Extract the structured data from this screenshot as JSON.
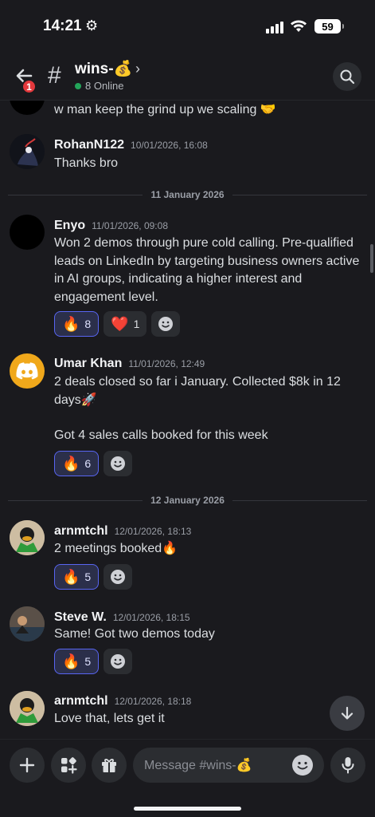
{
  "status_bar": {
    "time": "14:21",
    "battery": "59"
  },
  "header": {
    "back_badge": "1",
    "channel_name": "wins-💰",
    "online": "8 Online"
  },
  "messages": [
    {
      "text": "w man keep the grind up we scaling 🤝"
    },
    {
      "author": "RohanN122",
      "timestamp": "10/01/2026, 16:08",
      "text": "Thanks bro"
    },
    {
      "author": "Enyo",
      "timestamp": "11/01/2026, 09:08",
      "text": "Won 2 demos through pure cold calling. Pre-qualified leads on LinkedIn by targeting business owners active in AI groups, indicating a higher interest and engagement level.",
      "reactions": [
        {
          "emoji": "🔥",
          "count": "8"
        },
        {
          "emoji": "❤️",
          "count": "1"
        }
      ]
    },
    {
      "author": "Umar Khan",
      "timestamp": "11/01/2026, 12:49",
      "text": "2 deals closed so far i January. Collected $8k in 12 days🚀",
      "text2": "Got 4 sales calls booked for this week",
      "reactions": [
        {
          "emoji": "🔥",
          "count": "6"
        }
      ]
    },
    {
      "author": "arnmtchl",
      "timestamp": "12/01/2026, 18:13",
      "text": "2 meetings booked🔥",
      "reactions": [
        {
          "emoji": "🔥",
          "count": "5"
        }
      ]
    },
    {
      "author": "Steve W.",
      "timestamp": "12/01/2026, 18:15",
      "text": "Same! Got two demos today",
      "reactions": [
        {
          "emoji": "🔥",
          "count": "5"
        }
      ]
    },
    {
      "author": "arnmtchl",
      "timestamp": "12/01/2026, 18:18",
      "text": "Love that, lets get it"
    }
  ],
  "dividers": [
    "11 January 2026",
    "12 January 2026"
  ],
  "composer": {
    "placeholder": "Message #wins-💰"
  },
  "colors": {
    "accent": "#5865f2",
    "online": "#23a55a",
    "badge": "#e3383c",
    "background": "#1a1a1e"
  }
}
